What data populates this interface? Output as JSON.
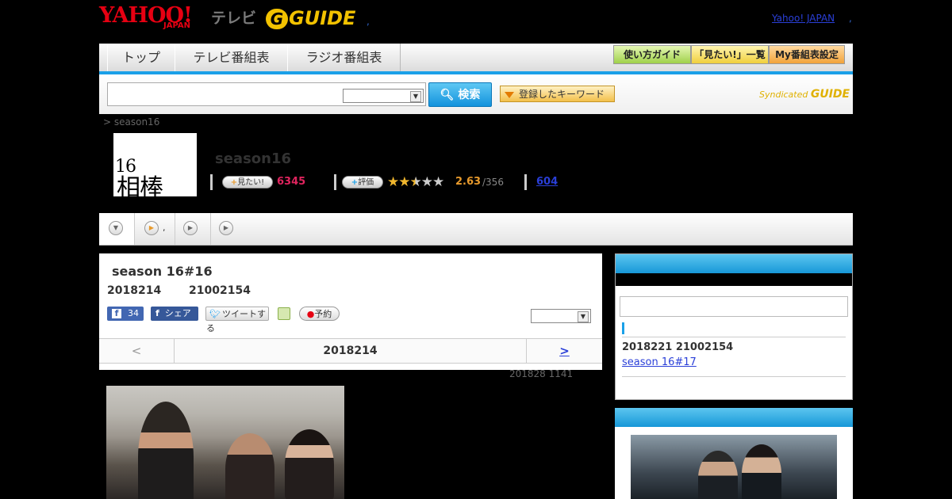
{
  "header": {
    "yahoo_logo": "YAHOO!",
    "yahoo_japan_sub": "JAPAN",
    "tv_label": "テレビ",
    "gguide_logo": "GUIDE",
    "top_link_dot": ",",
    "yahoo_japan_link": "Yahoo! JAPAN",
    "yahoo_japan_link_dot": ","
  },
  "nav": {
    "tabs": [
      "トップ",
      "テレビ番組表",
      "ラジオ番組表"
    ],
    "buttons": [
      "使い方ガイド",
      "「見たい!」一覧",
      "My番組表設定"
    ]
  },
  "search": {
    "placeholder": "",
    "button_label": "検索",
    "keyword_label": "登録したキーワード",
    "syndicated_label": "Syndicated",
    "syndicated_brand": "GUIDE"
  },
  "breadcrumb": "> season16",
  "program": {
    "thumb_text": "相棒",
    "thumb_num": "16",
    "title": "season16",
    "want_label": "見たい!",
    "want_count": "6345",
    "rating_label": "評価",
    "rating_stars": "★★★★★",
    "rating_value": "2.63",
    "rating_total": "/356",
    "review_count": "604"
  },
  "subtabs": [
    ",",
    "",
    ""
  ],
  "episode": {
    "title": "season 16#16",
    "air_date": "2018214",
    "air_time": "21002154",
    "fb_like_count": "34",
    "fb_share_label": "シェア",
    "tweet_label": "ツイートする",
    "reserve_label": "予約",
    "pager_prev": "<",
    "pager_date": "2018214",
    "pager_next": ">",
    "updated": "201828  1141"
  },
  "sidebar": {
    "next_date": "2018221  21002154",
    "next_link": " season 16#17 "
  },
  "colors": {
    "accent_blue": "#1aa0e8",
    "want_pink": "#e0245e",
    "rating_orange": "#e89a2c",
    "link_blue": "#2a3fd8"
  }
}
